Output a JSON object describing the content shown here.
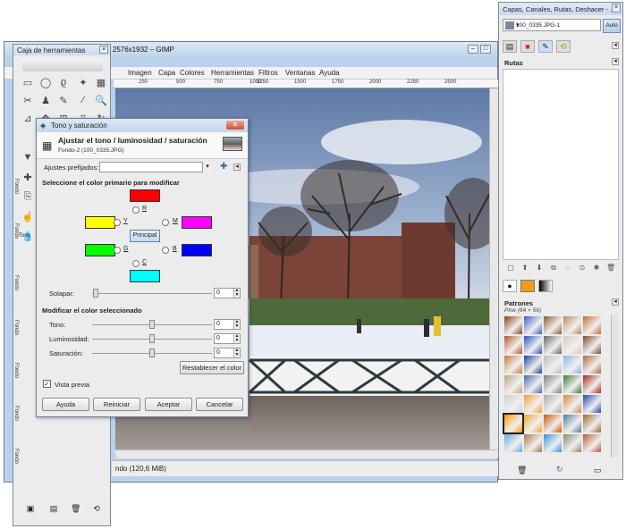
{
  "main_window": {
    "title": "- 2576x1932 – GIMP",
    "menu": [
      "Imagen",
      "Capa",
      "Colores",
      "Herramientas",
      "Filtros",
      "Ventanas",
      "Ayuda"
    ],
    "ruler_ticks": [
      "250",
      "500",
      "750",
      "1000",
      "1250",
      "1500",
      "1750",
      "2000",
      "2250",
      "2500"
    ],
    "status_text": "ndo (120,6 MiB)"
  },
  "toolbox": {
    "title": "Caja de herramientas",
    "side_labels": [
      "Fondo",
      "Fondo",
      "Tono",
      "Fondo",
      "Fondo",
      "Fondo",
      "Fondo",
      "Fondo"
    ]
  },
  "dialog": {
    "title": "Tono y saturación",
    "heading": "Ajustar el tono / luminosidad / saturación",
    "subheading": "Fondo-2 (100_0335.JPG)",
    "presets_label": "Ajustes prefijados:",
    "section_primary": "Seleccione el color primario para modificar",
    "radios": {
      "R": "R",
      "Y": "Y",
      "G": "G",
      "C": "C",
      "B": "B",
      "M": "M"
    },
    "principal_label": "Principal",
    "overlap_label": "Solapar:",
    "overlap_value": "0",
    "section_modify": "Modificar el color seleccionado",
    "hue_label": "Tono:",
    "hue_value": "0",
    "lightness_label": "Luminosidad:",
    "lightness_value": "0",
    "saturation_label": "Saturación:",
    "saturation_value": "0",
    "reset_color_label": "Restablecer el color",
    "preview_label": "Vista previa",
    "preview_checked": true,
    "buttons": {
      "help": "Ayuda",
      "reset": "Reiniciar",
      "ok": "Aceptar",
      "cancel": "Cancelar"
    },
    "colors": {
      "R": "#ff0000",
      "Y": "#ffff00",
      "G": "#00ff00",
      "C": "#00ffff",
      "B": "#0000ff",
      "M": "#ff00ff"
    }
  },
  "dock": {
    "title": "Capas, Canales, Rutas, Deshacer - ...",
    "image_name": "100_0335.JPG-1",
    "auto_label": "Auto",
    "paths_title": "Rutas",
    "patterns_title": "Patrones",
    "pattern_name": "Pine (64 × 56)"
  }
}
